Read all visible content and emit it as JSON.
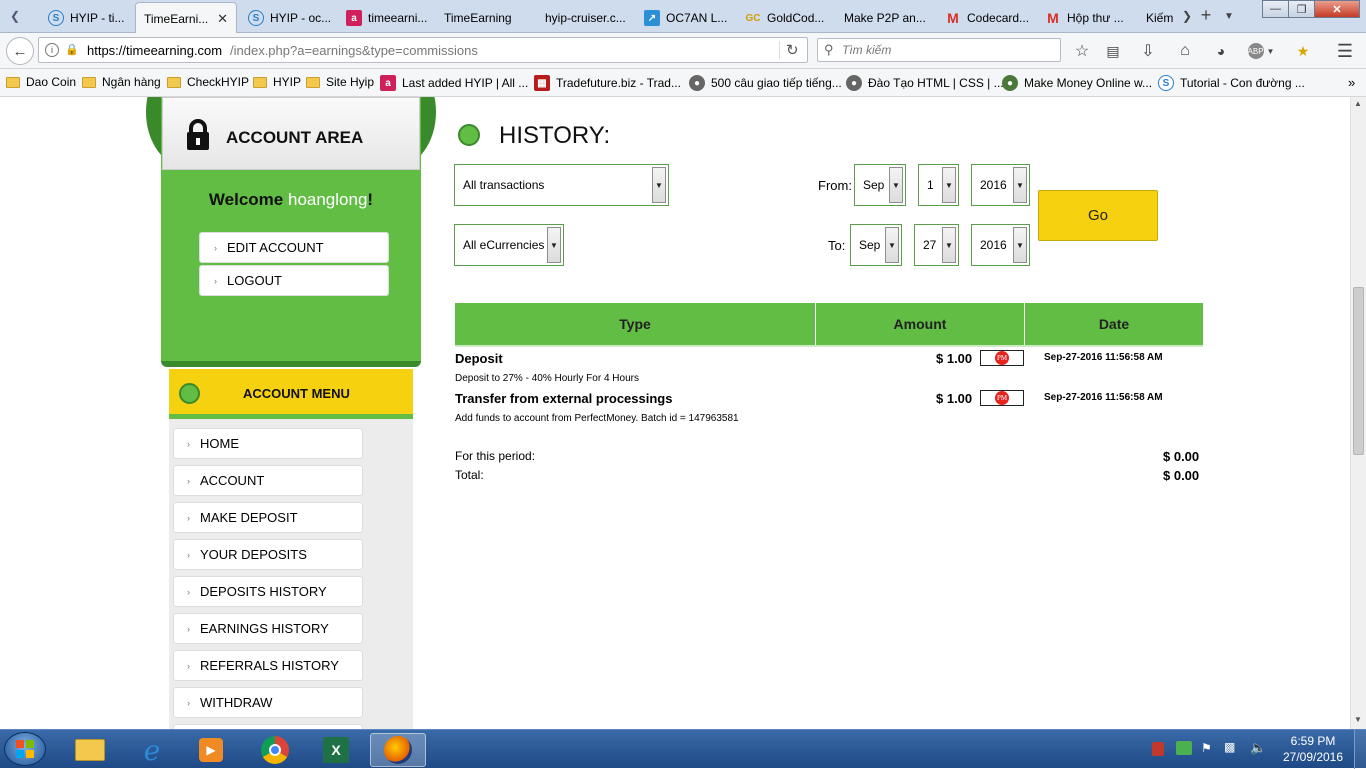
{
  "browser": {
    "tabs": [
      {
        "label": "HYIP - ti...",
        "icon": "s-icon"
      },
      {
        "label": "TimeEarni...",
        "icon": "none",
        "active": true
      },
      {
        "label": "HYIP - oc...",
        "icon": "s-icon"
      },
      {
        "label": "timeearni...",
        "icon": "a-icon"
      },
      {
        "label": "TimeEarning",
        "icon": "none"
      },
      {
        "label": "hyip-cruiser.c...",
        "icon": "none"
      },
      {
        "label": "OC7AN L...",
        "icon": "arrow-icon"
      },
      {
        "label": "GoldCod...",
        "icon": "gc-icon"
      },
      {
        "label": "Make P2P an...",
        "icon": "none"
      },
      {
        "label": "Codecard...",
        "icon": "gmail-icon"
      },
      {
        "label": "Hộp thư ...",
        "icon": "gmail-icon"
      },
      {
        "label": "Kiếm",
        "icon": "none"
      }
    ],
    "url": "https://timeearning.com/index.php?a=earnings&type=commissions",
    "url_host": "https://timeearning.com",
    "url_path": "/index.php?a=earnings&type=commissions",
    "search_placeholder": "Tìm kiếm",
    "bookmarks": [
      {
        "label": "Dao Coin",
        "icon": "folder"
      },
      {
        "label": "Ngân hàng",
        "icon": "folder"
      },
      {
        "label": "CheckHYIP",
        "icon": "folder"
      },
      {
        "label": "HYIP",
        "icon": "folder"
      },
      {
        "label": "Site Hyip",
        "icon": "folder"
      },
      {
        "label": "Last added HYIP | All ...",
        "icon": "a-icon"
      },
      {
        "label": "Tradefuture.biz - Trad...",
        "icon": "grid-icon"
      },
      {
        "label": "500 câu giao tiếp tiếng...",
        "icon": "globe-icon"
      },
      {
        "label": "Đào Tạo HTML | CSS | ...",
        "icon": "globe-icon"
      },
      {
        "label": "Make Money Online w...",
        "icon": "green-icon"
      },
      {
        "label": "Tutorial - Con đường ...",
        "icon": "s-icon"
      }
    ]
  },
  "sidebar": {
    "account_area_title": "ACCOUNT AREA",
    "welcome_prefix": "Welcome ",
    "username": "hoanglong",
    "welcome_suffix": "!",
    "edit_account": "EDIT ACCOUNT",
    "logout": "LOGOUT",
    "account_menu_title": "ACCOUNT MENU",
    "menu_items": [
      "HOME",
      "ACCOUNT",
      "MAKE DEPOSIT",
      "YOUR DEPOSITS",
      "DEPOSITS HISTORY",
      "EARNINGS HISTORY",
      "REFERRALS HISTORY",
      "WITHDRAW"
    ]
  },
  "main": {
    "title": "HISTORY:",
    "filters": {
      "type_selected": "All transactions",
      "currency_selected": "All eCurrencies",
      "from_label": "From:",
      "to_label": "To:",
      "from_month": "Sep",
      "from_day": "1",
      "from_year": "2016",
      "to_month": "Sep",
      "to_day": "27",
      "to_year": "2016",
      "go_label": "Go"
    },
    "table": {
      "headers": [
        "Type",
        "Amount",
        "Date"
      ],
      "rows": [
        {
          "type": "Deposit",
          "description": "Deposit to 27% - 40% Hourly For 4 Hours",
          "amount": "$ 1.00",
          "currency_badge": "PM",
          "date": "Sep-27-2016 11:56:58 AM"
        },
        {
          "type": "Transfer from external processings",
          "description": "Add funds to account from PerfectMoney. Batch id = 147963581",
          "amount": "$ 1.00",
          "currency_badge": "PM",
          "date": "Sep-27-2016 11:56:58 AM"
        }
      ],
      "period_label": "For this period:",
      "period_value": "$ 0.00",
      "total_label": "Total:",
      "total_value": "$ 0.00"
    }
  },
  "taskbar": {
    "time": "6:59 PM",
    "date": "27/09/2016"
  },
  "colors": {
    "green": "#62bd45",
    "yellow": "#f5d10f",
    "dark_green": "#3a8a2c"
  }
}
